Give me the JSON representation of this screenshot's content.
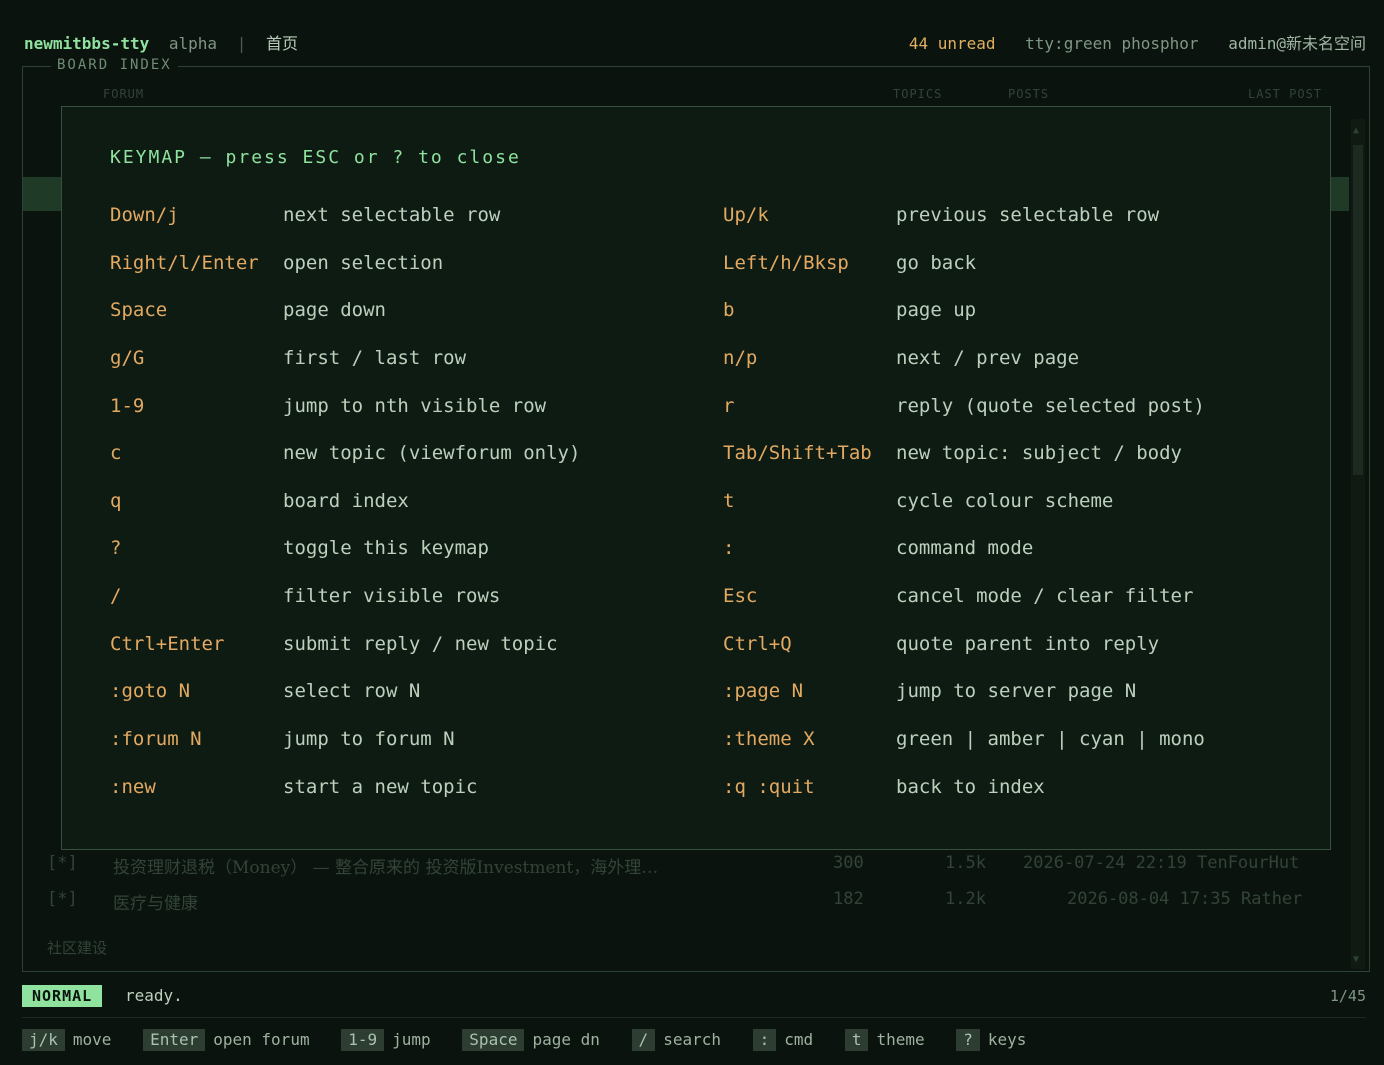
{
  "header": {
    "app_name": "newmitbbs-tty",
    "channel": "alpha",
    "separator": "|",
    "breadcrumb": "首页",
    "unread": "44 unread",
    "theme": "tty:green phosphor",
    "user": "admin@新未名空间"
  },
  "board": {
    "title": "BOARD INDEX",
    "columns": [
      "FORUM",
      "TOPICS",
      "POSTS",
      "LAST POST"
    ],
    "visible_rows": [
      {
        "marker": "[*]",
        "name": "投资理财退税（Money） — 整合原来的 投资版Investment，海外理…",
        "topics": "300",
        "posts": "1.5k",
        "last": "2026-07-24 22:19 TenFourHut"
      },
      {
        "marker": "[*]",
        "name": "医疗与健康",
        "topics": "182",
        "posts": "1.2k",
        "last": "2026-08-04 17:35 Rather"
      }
    ],
    "section_label": "社区建设"
  },
  "keymap": {
    "title": "KEYMAP — press ESC or ? to close",
    "rows": [
      {
        "k1": "Down/j",
        "d1": "next selectable row",
        "k2": "Up/k",
        "d2": "previous selectable row"
      },
      {
        "k1": "Right/l/Enter",
        "d1": "open selection",
        "k2": "Left/h/Bksp",
        "d2": "go back"
      },
      {
        "k1": "Space",
        "d1": "page down",
        "k2": "b",
        "d2": "page up"
      },
      {
        "k1": "g/G",
        "d1": "first / last row",
        "k2": "n/p",
        "d2": "next / prev page"
      },
      {
        "k1": "1-9",
        "d1": "jump to nth visible row",
        "k2": "r",
        "d2": "reply (quote selected post)"
      },
      {
        "k1": "c",
        "d1": "new topic (viewforum only)",
        "k2": "Tab/Shift+Tab",
        "d2": "new topic: subject / body"
      },
      {
        "k1": "q",
        "d1": "board index",
        "k2": "t",
        "d2": "cycle colour scheme"
      },
      {
        "k1": "?",
        "d1": "toggle this keymap",
        "k2": ":",
        "d2": "command mode"
      },
      {
        "k1": "/",
        "d1": "filter visible rows",
        "k2": "Esc",
        "d2": "cancel mode / clear filter"
      },
      {
        "k1": "Ctrl+Enter",
        "d1": "submit reply / new topic",
        "k2": "Ctrl+Q",
        "d2": "quote parent into reply"
      },
      {
        "k1": ":goto N",
        "d1": "select row N",
        "k2": ":page N",
        "d2": "jump to server page N"
      },
      {
        "k1": ":forum N",
        "d1": "jump to forum N",
        "k2": ":theme X",
        "d2": "green | amber | cyan | mono"
      },
      {
        "k1": ":new",
        "d1": "start a new topic",
        "k2": ":q :quit",
        "d2": "back to index"
      }
    ]
  },
  "status": {
    "mode": "NORMAL",
    "message": "ready.",
    "page": "1/45"
  },
  "hints": [
    {
      "key": "j/k",
      "label": "move"
    },
    {
      "key": "Enter",
      "label": "open forum"
    },
    {
      "key": "1-9",
      "label": "jump"
    },
    {
      "key": "Space",
      "label": "page dn"
    },
    {
      "key": "/",
      "label": "search"
    },
    {
      "key": ":",
      "label": "cmd"
    },
    {
      "key": "t",
      "label": "theme"
    },
    {
      "key": "?",
      "label": "keys"
    }
  ],
  "colors": {
    "background": "#0b130e",
    "accent_green": "#8fe39f",
    "key_amber": "#e3a962",
    "unread_amber": "#e0b062"
  }
}
